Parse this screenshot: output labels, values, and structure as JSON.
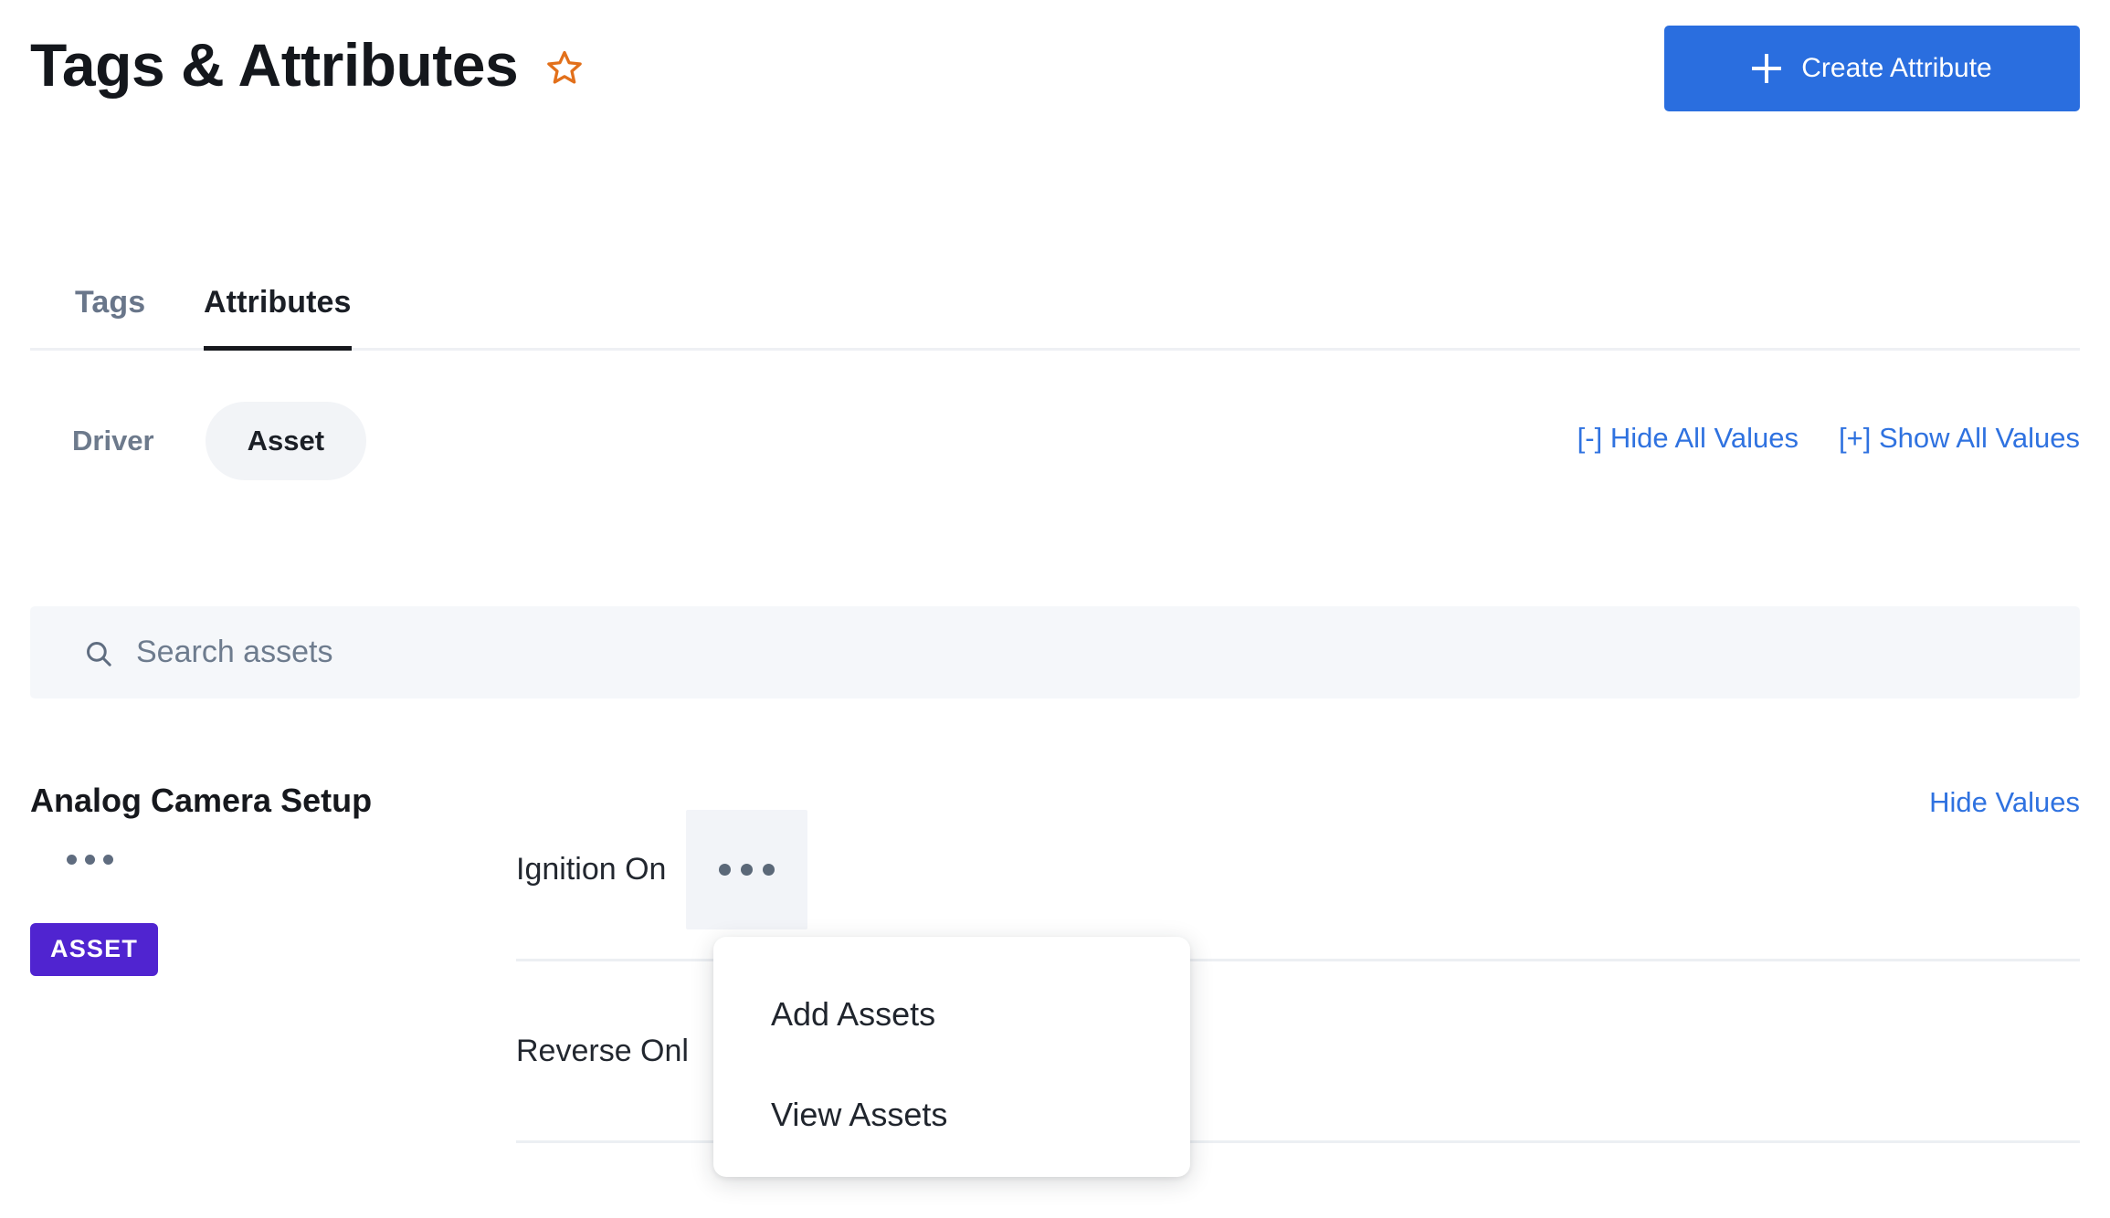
{
  "header": {
    "title": "Tags & Attributes",
    "favorite_icon": "star-icon",
    "create_button_label": "Create Attribute",
    "create_button_icon": "plus-icon",
    "accent_blue": "#2a6edf",
    "star_color": "#e2701b"
  },
  "tabs": [
    {
      "label": "Tags",
      "active": false
    },
    {
      "label": "Attributes",
      "active": true
    }
  ],
  "filters": {
    "segments": [
      {
        "label": "Driver",
        "active": false
      },
      {
        "label": "Asset",
        "active": true
      }
    ],
    "hide_all_values": "[-] Hide All Values",
    "show_all_values": "[+] Show All Values",
    "link_color": "#2f72e0"
  },
  "search": {
    "icon": "search-icon",
    "placeholder": "Search assets",
    "value": ""
  },
  "group": {
    "title": "Analog Camera Setup",
    "menu_icon": "ellipsis-icon",
    "badge": "ASSET",
    "badge_color": "#5024d0",
    "hide_values_label": "Hide Values",
    "values": [
      {
        "label": "Ignition On",
        "has_menu": true,
        "menu_open": true
      },
      {
        "label": "Reverse Onl",
        "has_menu": false,
        "menu_open": false
      }
    ]
  },
  "dropdown": {
    "open": true,
    "items": [
      {
        "label": "Add Assets"
      },
      {
        "label": "View Assets"
      }
    ]
  }
}
